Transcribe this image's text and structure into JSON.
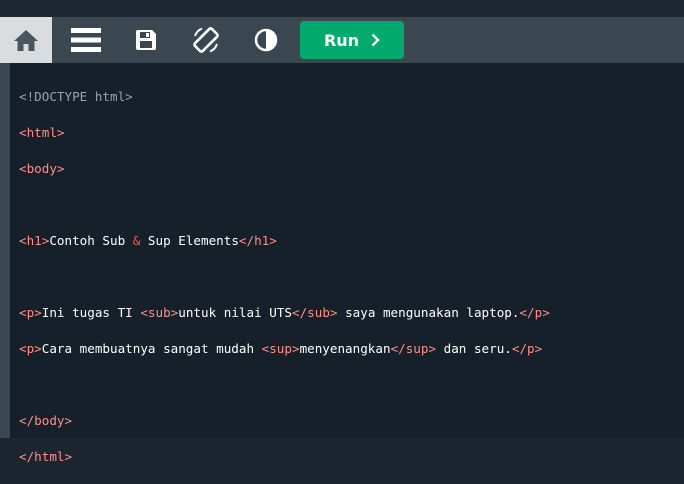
{
  "toolbar": {
    "buttons": [
      {
        "name": "home",
        "icon": "home-icon"
      },
      {
        "name": "menu",
        "icon": "menu-icon"
      },
      {
        "name": "save",
        "icon": "save-icon"
      },
      {
        "name": "rotate",
        "icon": "rotate-icon"
      },
      {
        "name": "theme",
        "icon": "contrast-icon"
      }
    ],
    "run_label": "Run",
    "run_icon": "chevron-right-icon",
    "colors": {
      "run": "#04aa6d",
      "toolbar": "#3a4650",
      "active": "#d9dde0"
    }
  },
  "editor": {
    "colors": {
      "background": "#15202a",
      "tag": "#ff8e86",
      "doctype": "#9aa3ab",
      "entity": "#ff5252",
      "text": "#ffffff"
    },
    "l1": {
      "doctype": "<!DOCTYPE html>"
    },
    "l2": {
      "t1": "<html>"
    },
    "l3": {
      "t1": "<body>"
    },
    "l5": {
      "t1": "<h1>",
      "x1": "Contoh Sub ",
      "amp": "&",
      "x2": " Sup Elements",
      "t2": "</h1>"
    },
    "l7": {
      "t1": "<p>",
      "x1": "Ini tugas TI ",
      "t2": "<sub>",
      "x2": "untuk nilai UTS",
      "t3": "</sub>",
      "x3": " saya mengunakan laptop.",
      "t4": "</p>"
    },
    "l8": {
      "t1": "<p>",
      "x1": "Cara membuatnya sangat mudah ",
      "t2": "<sup>",
      "x2": "menyenangkan",
      "t3": "</sup>",
      "x3": " dan seru.",
      "t4": "</p>"
    },
    "l10": {
      "t1": "</body>"
    },
    "l11": {
      "t1": "</html>"
    }
  }
}
